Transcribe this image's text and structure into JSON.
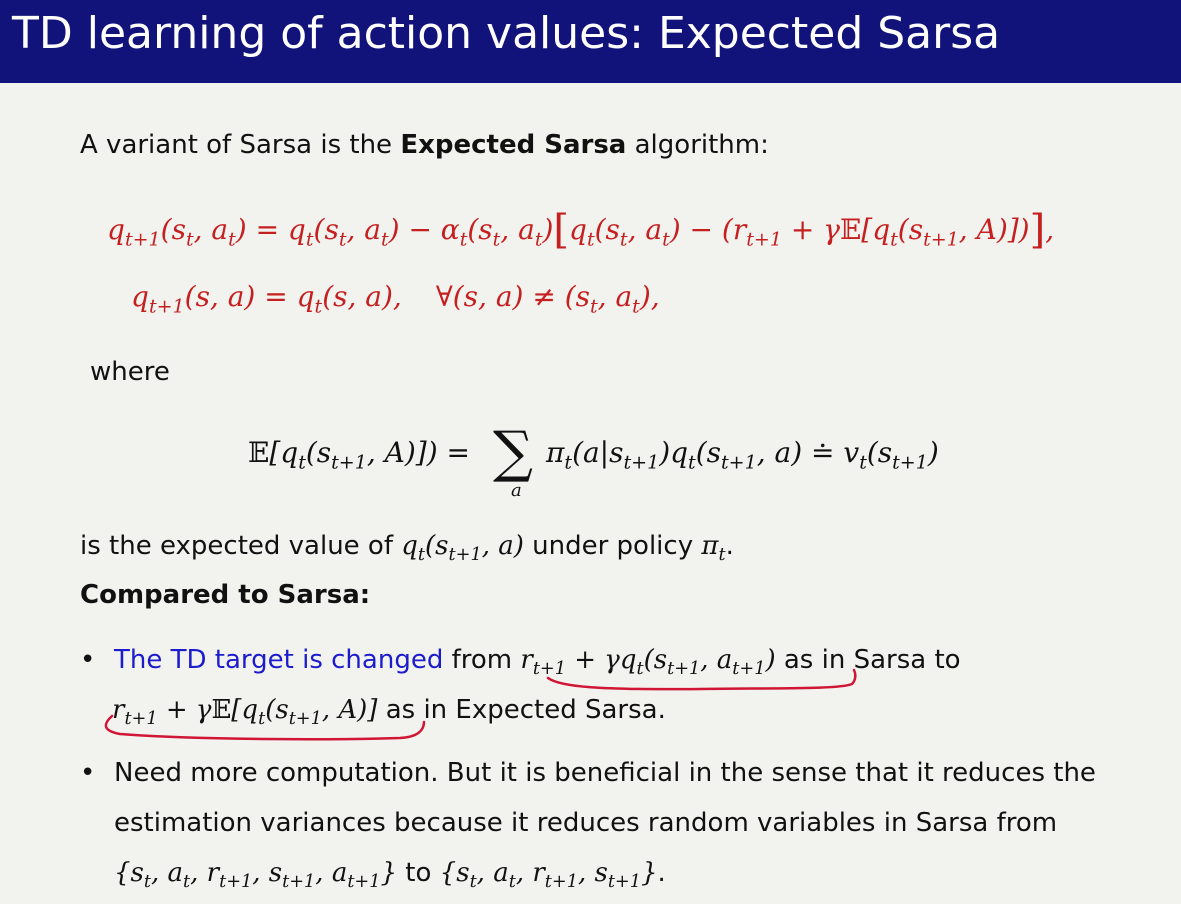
{
  "title": "TD learning of action values: Expected Sarsa",
  "intro": {
    "prefix": "A variant of Sarsa is the ",
    "bold": "Expected Sarsa",
    "suffix": " algorithm:"
  },
  "equation1": {
    "lhs": "q",
    "lhs_sub": "t+1",
    "body_1": "(s",
    "body_1_sub": "t",
    "body_2": ", a",
    "body_2_sub": "t",
    "body_3": ") = q",
    "body_3_sub": "t",
    "body_4": "(s",
    "body_4_sub": "t",
    "body_5": ", a",
    "body_5_sub": "t",
    "body_6": ") − α",
    "body_6_sub": "t",
    "body_7": "(s",
    "body_7_sub": "t",
    "body_8": ", a",
    "body_8_sub": "t",
    "body_9": ")",
    "bracket_open": "[",
    "in_1": "q",
    "in_1_sub": "t",
    "in_2": "(s",
    "in_2_sub": "t",
    "in_3": ", a",
    "in_3_sub": "t",
    "in_4": ") − (r",
    "in_4_sub": "t+1",
    "in_5": " + γ",
    "in_bb": "𝔼",
    "in_6": "[q",
    "in_6_sub": "t",
    "in_7": "(s",
    "in_7_sub": "t+1",
    "in_8": ", A)])",
    "bracket_close": "]",
    "tail": ","
  },
  "equation2": {
    "a": "q",
    "a_sub": "t+1",
    "b": "(s, a) = q",
    "b_sub": "t",
    "c": "(s, a),",
    "forall": "∀(s, a) ≠ (s",
    "forall_sub": "t",
    "d": ", a",
    "d_sub": "t",
    "e": "),"
  },
  "where": "where",
  "equation3": {
    "bb": "𝔼",
    "a": "[q",
    "a_sub": "t",
    "b": "(s",
    "b_sub": "t+1",
    "c": ", A)]) =",
    "sum": "∑",
    "sum_sub": "a",
    "d": "π",
    "d_sub": "t",
    "e": "(a|s",
    "e_sub": "t+1",
    "f": ")q",
    "f_sub": "t",
    "g": "(s",
    "g_sub": "t+1",
    "h": ", a) ≐ v",
    "h_sub": "t",
    "i": "(s",
    "i_sub": "t+1",
    "j": ")"
  },
  "expected_line": {
    "prefix": "is the expected value of ",
    "q": "q",
    "q_sub": "t",
    "q_arg": "(s",
    "q_arg_sub": "t+1",
    "q_end": ", a)",
    "mid": " under policy ",
    "pi": "π",
    "pi_sub": "t",
    "end": "."
  },
  "compared_heading": "Compared to Sarsa:",
  "bullet1": {
    "marker": "•",
    "blue_text": "The TD target is changed",
    "from": " from ",
    "t1_r": "r",
    "t1_r_sub": "t+1",
    "t1_a": " + γq",
    "t1_a_sub": "t",
    "t1_b": "(s",
    "t1_b_sub": "t+1",
    "t1_c": ", a",
    "t1_c_sub": "t+1",
    "t1_d": ")",
    "as_sarsa": " as in Sarsa to",
    "t2_r": "r",
    "t2_r_sub": "t+1",
    "t2_a": " + γ",
    "t2_bb": "𝔼",
    "t2_b": "[q",
    "t2_b_sub": "t",
    "t2_c": "(s",
    "t2_c_sub": "t+1",
    "t2_d": ", A)]",
    "as_expected": " as in Expected Sarsa."
  },
  "bullet2": {
    "marker": "•",
    "line1": "Need more computation. But it is beneficial in the sense that it reduces the",
    "line2": "estimation variances because it reduces random variables in Sarsa from",
    "set1_open": "{s",
    "set1_a_sub": "t",
    "set1_b": ", a",
    "set1_b_sub": "t",
    "set1_c": ", r",
    "set1_c_sub": "t+1",
    "set1_d": ", s",
    "set1_d_sub": "t+1",
    "set1_e": ", a",
    "set1_e_sub": "t+1",
    "set1_close": "}",
    "to": " to ",
    "set2_open": "{s",
    "set2_a_sub": "t",
    "set2_b": ", a",
    "set2_b_sub": "t",
    "set2_c": ", r",
    "set2_c_sub": "t+1",
    "set2_d": ", s",
    "set2_d_sub": "t+1",
    "set2_close": "}",
    "end": "."
  },
  "colors": {
    "title_bg": "#12137a",
    "equation_red": "#c51f1f",
    "highlight_blue": "#1c1ccd",
    "underline_red": "#d01535"
  }
}
